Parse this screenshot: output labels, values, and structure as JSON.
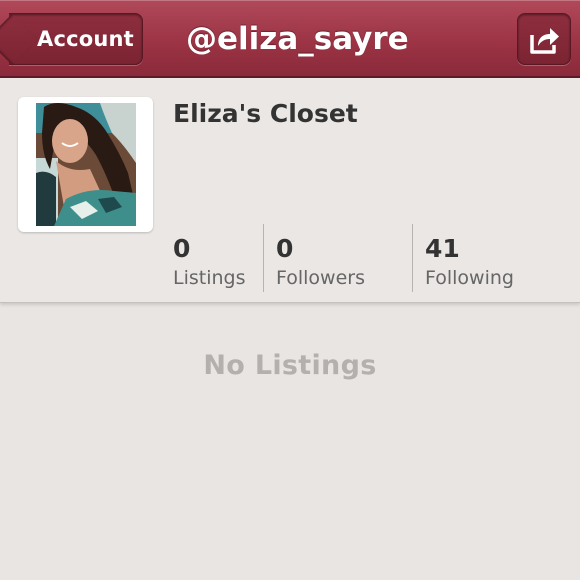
{
  "navbar": {
    "back_label": "Account",
    "title": "@eliza_sayre",
    "share_icon": "share-icon",
    "bar_color": "#9c3445"
  },
  "profile": {
    "closet_name": "Eliza's Closet",
    "avatar_icon": "profile-photo",
    "stats": [
      {
        "count": "0",
        "label": "Listings"
      },
      {
        "count": "0",
        "label": "Followers"
      },
      {
        "count": "41",
        "label": "Following"
      }
    ]
  },
  "content": {
    "empty_message": "No Listings"
  }
}
